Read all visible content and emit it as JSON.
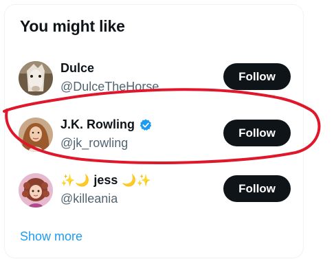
{
  "widget": {
    "title": "You might like",
    "show_more_label": "Show more"
  },
  "suggestions": [
    {
      "name": "Dulce",
      "handle": "@DulceTheHorse",
      "verified": false,
      "follow_label": "Follow"
    },
    {
      "name": "J.K. Rowling",
      "handle": "@jk_rowling",
      "verified": true,
      "follow_label": "Follow"
    },
    {
      "name_prefix": "✨🌙",
      "name": "jess",
      "name_suffix": "🌙✨",
      "handle": "@killeania",
      "verified": false,
      "follow_label": "Follow"
    }
  ],
  "colors": {
    "follow_button_bg": "#0f1419",
    "link": "#1d9bf0",
    "verified_badge": "#1d9bf0",
    "annotation_circle": "#e0162b"
  }
}
